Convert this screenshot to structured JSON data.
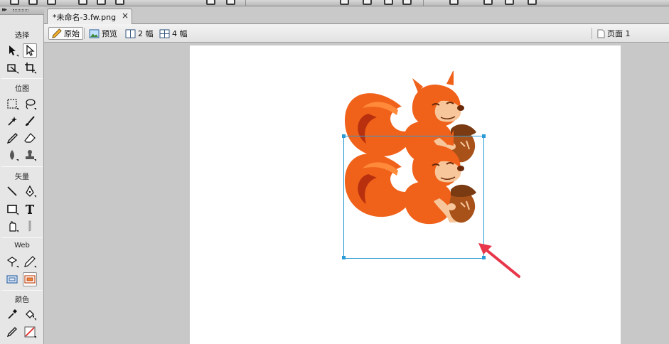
{
  "document": {
    "tab_title": "*未命名-3.fw.png",
    "close_glyph": "×",
    "page_label": "页面 1"
  },
  "view_modes": [
    {
      "label": "原始",
      "icon": "pencil-icon",
      "active": true
    },
    {
      "label": "预览",
      "icon": "image-icon",
      "active": false
    },
    {
      "label": "2 幅",
      "icon": "two-up-icon",
      "active": false
    },
    {
      "label": "4 幅",
      "icon": "four-up-icon",
      "active": false
    }
  ],
  "tools_panel": {
    "sections": [
      {
        "title": "选择",
        "tools": [
          "pointer-tool-icon",
          "subselect-tool-icon",
          "scale-tool-icon",
          "crop-tool-icon"
        ]
      },
      {
        "title": "位图",
        "tools": [
          "marquee-tool-icon",
          "lasso-tool-icon",
          "magic-wand-tool-icon",
          "brush-tool-icon",
          "pencil-tool-icon",
          "eraser-tool-icon",
          "blur-tool-icon",
          "rubber-stamp-tool-icon"
        ]
      },
      {
        "title": "矢量",
        "tools": [
          "line-tool-icon",
          "pen-tool-icon",
          "rectangle-tool-icon",
          "text-tool-icon",
          "freeform-tool-icon",
          "knife-tool-icon"
        ]
      },
      {
        "title": "Web",
        "tools": [
          "hotspot-tool-icon",
          "slice-tool-icon",
          "hide-slices-icon",
          "show-slices-icon"
        ]
      },
      {
        "title": "颜色",
        "tools": [
          "eyedropper-tool-icon",
          "paint-bucket-tool-icon",
          "stroke-color-icon",
          "fill-color-icon"
        ]
      }
    ]
  },
  "colors": {
    "selection": "#2a9bd6",
    "annotation_arrow": "#e8364a",
    "squirrel_fur": "#f0611a"
  }
}
